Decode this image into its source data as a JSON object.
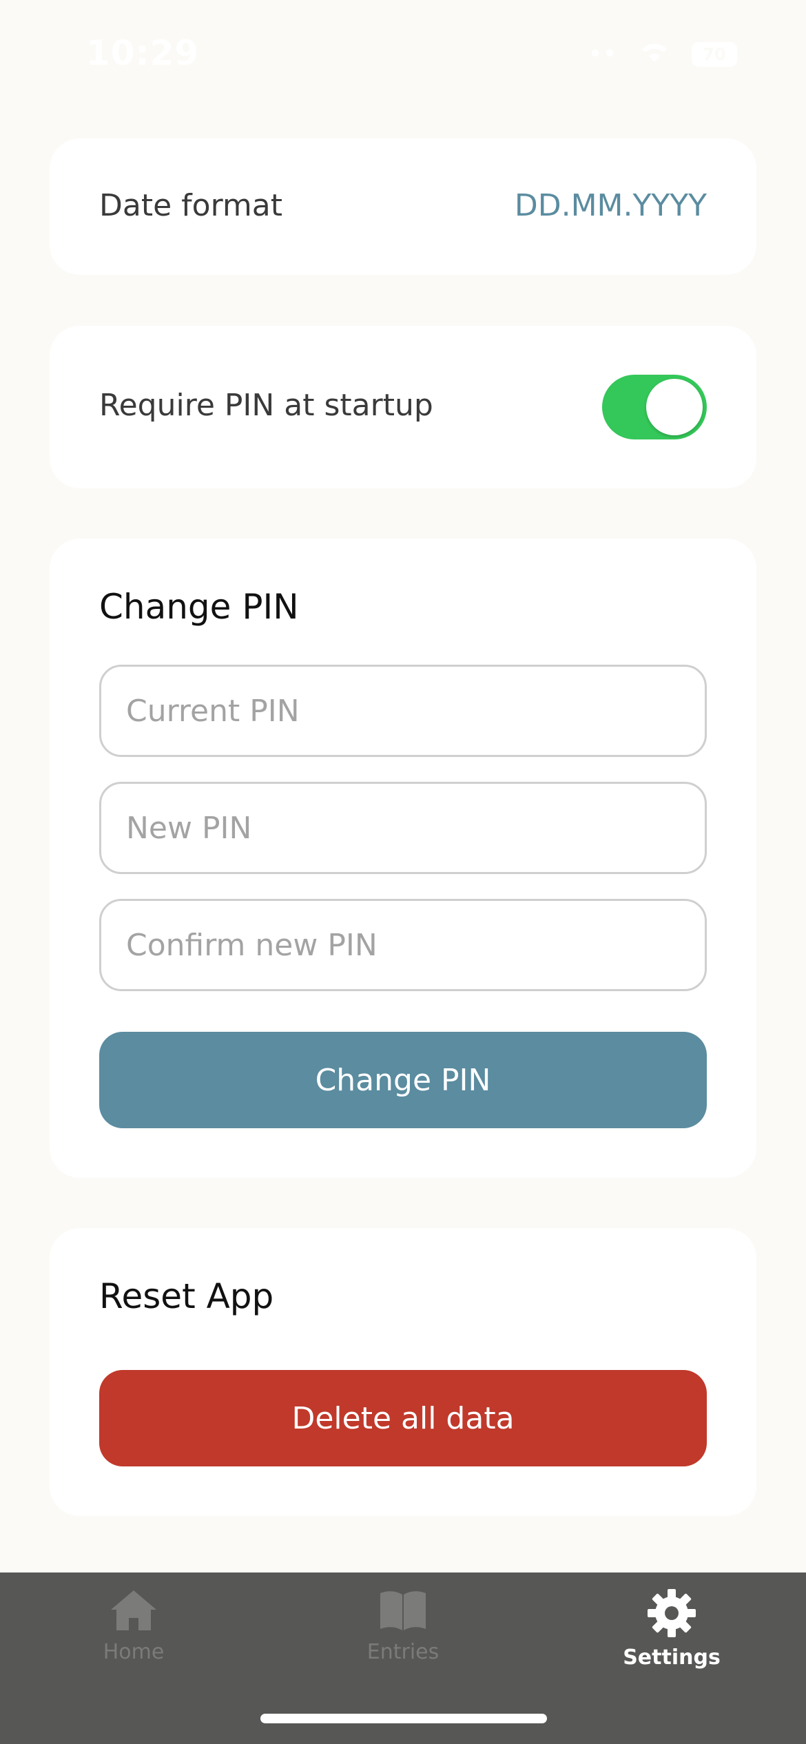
{
  "status_bar": {
    "time": "10:29",
    "battery": "70"
  },
  "date_format": {
    "label": "Date format",
    "value": "DD.MM.YYYY"
  },
  "pin_startup": {
    "label": "Require PIN at startup",
    "enabled": true
  },
  "change_pin": {
    "title": "Change PIN",
    "current_placeholder": "Current PIN",
    "new_placeholder": "New PIN",
    "confirm_placeholder": "Confirm new PIN",
    "button_label": "Change PIN"
  },
  "reset": {
    "title": "Reset App",
    "button_label": "Delete all data"
  },
  "tabs": [
    {
      "label": "Home",
      "icon": "home-icon",
      "active": false
    },
    {
      "label": "Entries",
      "icon": "book-icon",
      "active": false
    },
    {
      "label": "Settings",
      "icon": "gear-icon",
      "active": true
    }
  ],
  "colors": {
    "accent": "#5b8ca0",
    "danger": "#c0392b",
    "toggle_on": "#34c759",
    "background": "#fcfaf6",
    "tab_bar": "#575755"
  }
}
